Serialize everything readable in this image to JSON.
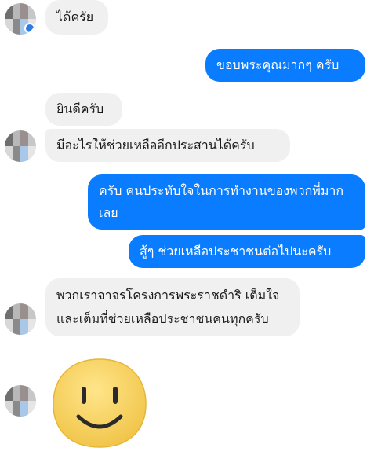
{
  "messages": [
    {
      "text": "ได้ครัย"
    },
    {
      "text": "ขอบพระคุณมากๆ ครับ"
    },
    {
      "text": "ยินดีครับ"
    },
    {
      "text": "มีอะไรให้ช่วยเหลืออีกประสานได้ครับ"
    },
    {
      "text": "ครับ คนประทับใจในการทำงานของพวกพี่มากเลย"
    },
    {
      "text": "สู้ๆ ช่วยเหลือประชาชนต่อไปนะครับ"
    },
    {
      "text": "พวกเราจาจรโครงการพระราชดำริ เต็มใจและเต็มที่ช่วยเหลือประชาชนคนทุกครับ"
    }
  ],
  "sticker": {
    "icon": "smiley-face-icon",
    "fill": "#f5cf55",
    "stroke": "#2a2a2a"
  },
  "colors": {
    "outgoing": "#0a7cff",
    "incoming": "#f1f0f0"
  }
}
